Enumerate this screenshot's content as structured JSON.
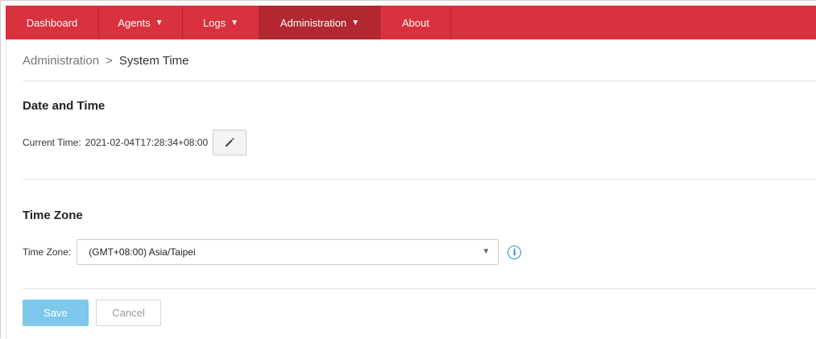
{
  "nav": {
    "dashboard": "Dashboard",
    "agents": "Agents",
    "logs": "Logs",
    "administration": "Administration",
    "about": "About",
    "caret": "▼"
  },
  "breadcrumb": {
    "parent": "Administration",
    "separator": ">",
    "current": "System Time"
  },
  "date_time": {
    "title": "Date and Time",
    "current_time_label": "Current Time:",
    "current_time_value": "2021-02-04T17:28:34+08:00",
    "edit_icon": "pencil-icon"
  },
  "time_zone": {
    "title": "Time Zone",
    "label": "Time Zone:",
    "selected": "(GMT+08:00) Asia/Taipei",
    "info_icon": "info-icon"
  },
  "actions": {
    "save_label": "Save",
    "cancel_label": "Cancel"
  },
  "colors": {
    "nav_bg": "#d9313e",
    "nav_active": "#b22730",
    "save_bg": "#7ec8ec",
    "info": "#2a8fd8"
  }
}
